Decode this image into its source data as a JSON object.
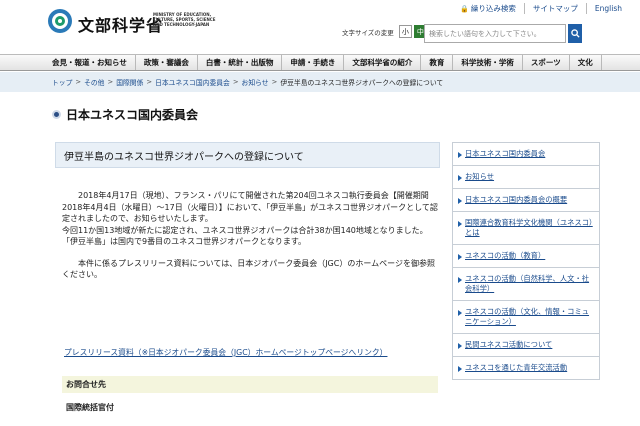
{
  "header": {
    "logo_text": "文部科学省",
    "logo_sub": "MINISTRY OF EDUCATION, CULTURE, SPORTS, SCIENCE AND TECHNOLOGY-JAPAN",
    "util_links": [
      {
        "label": "繰り込み検索",
        "icon": "lock-icon"
      },
      {
        "label": "サイトマップ"
      },
      {
        "label": "English"
      }
    ],
    "font_size_label": "文字サイズの変更",
    "font_sizes": [
      "小",
      "中",
      "大"
    ],
    "search_placeholder": "検索したい語句を入力して下さい。",
    "search_icon": "search-icon"
  },
  "nav": [
    "会見・報道・お知らせ",
    "政策・審議会",
    "白書・統計・出版物",
    "申請・手続き",
    "文部科学省の紹介",
    "教育",
    "科学技術・学術",
    "スポーツ",
    "文化"
  ],
  "breadcrumb": [
    "トップ",
    "その他",
    "国際関係",
    "日本ユネスコ国内委員会",
    "お知らせ",
    "伊豆半島のユネスコ世界ジオパークへの登録について"
  ],
  "page_title": "日本ユネスコ国内委員会",
  "article": {
    "title": "伊豆半島のユネスコ世界ジオパークへの登録について",
    "para1": "2018年4月17日（現地）、フランス・パリにて開催された第204回ユネスコ執行委員会【開催期間2018年4月4日（水曜日）～17日（火曜日）】において、「伊豆半島」がユネスコ世界ジオパークとして認定されましたので、お知らせいたします。",
    "para2": "今回11か国13地域が新たに認定され、ユネスコ世界ジオパークは合計38か国140地域となりました。「伊豆半島」は国内で9番目のユネスコ世界ジオパークとなります。",
    "para3": "本件に係るプレスリリース資料については、日本ジオパーク委員会（JGC）のホームページを御参照ください。",
    "link": "プレスリリース資料（※日本ジオパーク委員会（JGC）ホームページトップページへリンク）",
    "contact_head": "お問合せ先",
    "contact_body": "国際統括官付"
  },
  "sidebar": [
    "日本ユネスコ国内委員会",
    "お知らせ",
    "日本ユネスコ国内委員会の概要",
    "国際連合教育科学文化機関（ユネスコ）とは",
    "ユネスコの活動（教育）",
    "ユネスコの活動（自然科学、人文・社会科学）",
    "ユネスコの活動（文化、情報・コミュニケーション）",
    "民間ユネスコ活動について",
    "ユネスコを通じた青年交流活動"
  ]
}
